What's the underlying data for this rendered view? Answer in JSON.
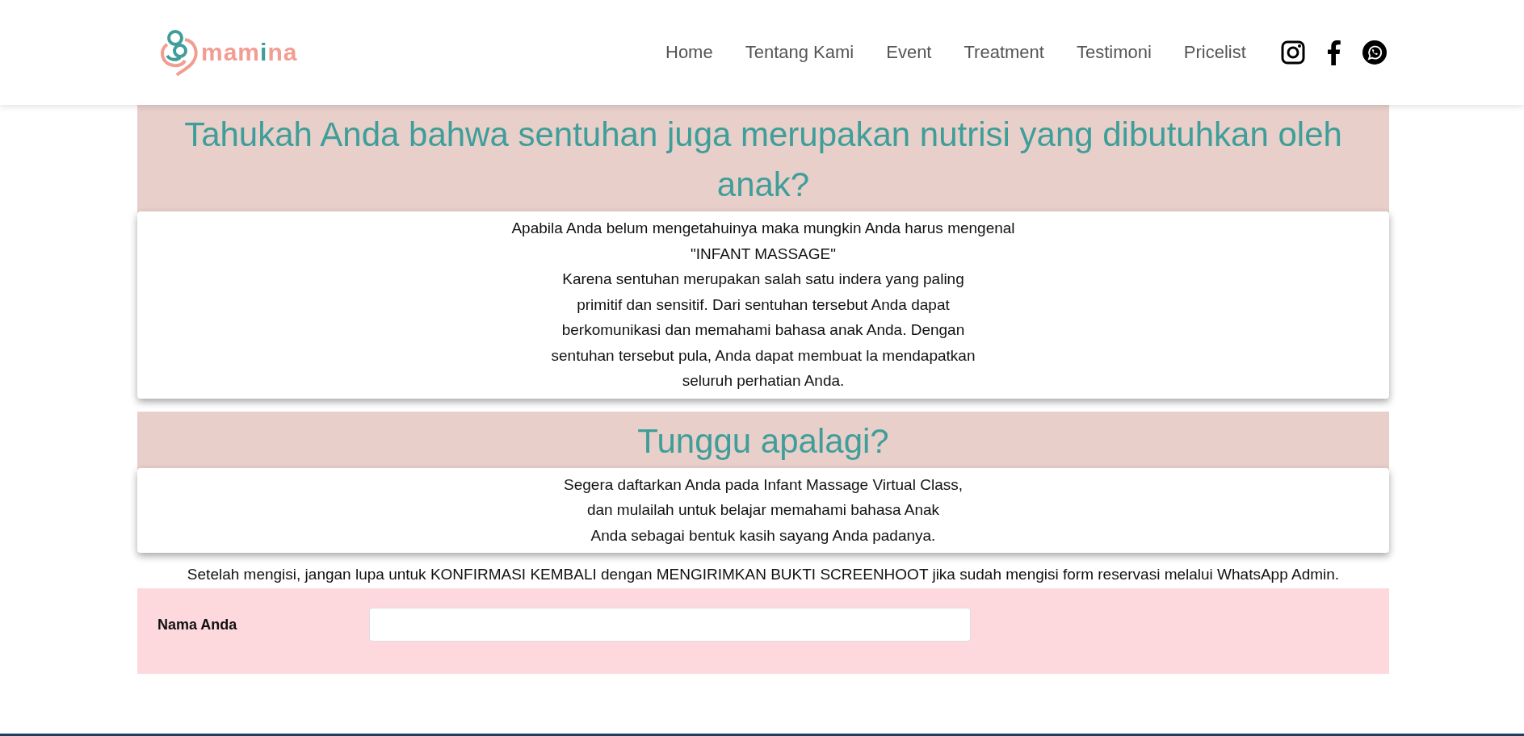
{
  "logo": {
    "parts": [
      {
        "text": "mam",
        "accent": false
      },
      {
        "text": "i",
        "accent": true
      },
      {
        "text": "na",
        "accent": false
      }
    ]
  },
  "nav": [
    "Home",
    "Tentang Kami",
    "Event",
    "Treatment",
    "Testimoni",
    "Pricelist"
  ],
  "social": [
    {
      "kind": "instagram"
    },
    {
      "kind": "facebook"
    },
    {
      "kind": "whatsapp"
    }
  ],
  "sections": [
    {
      "heading": "Tahukah Anda bahwa sentuhan juga merupakan nutrisi yang dibutuhkan oleh anak?",
      "lines": [
        "Apabila Anda belum mengetahuinya maka mungkin Anda harus mengenal",
        "\"INFANT MASSAGE\"",
        "Karena sentuhan merupakan salah satu indera yang paling",
        "primitif dan sensitif. Dari sentuhan tersebut Anda dapat",
        "berkomunikasi dan memahami bahasa anak Anda. Dengan",
        "sentuhan tersebut pula, Anda dapat membuat la mendapatkan",
        "seluruh perhatian Anda."
      ]
    },
    {
      "heading": "Tunggu apalagi?",
      "lines": [
        "Segera daftarkan Anda pada Infant Massage Virtual Class,",
        "dan mulailah untuk belajar memahami bahasa Anak",
        "Anda sebagai bentuk kasih sayang Anda padanya."
      ]
    }
  ],
  "notice": "Setelah mengisi, jangan lupa untuk KONFIRMASI KEMBALI dengan MENGIRIMKAN BUKTI SCREENHOOT jika sudah mengisi form reservasi melalui WhatsApp Admin.",
  "form": {
    "fields": [
      {
        "label": "Nama Anda"
      }
    ]
  }
}
